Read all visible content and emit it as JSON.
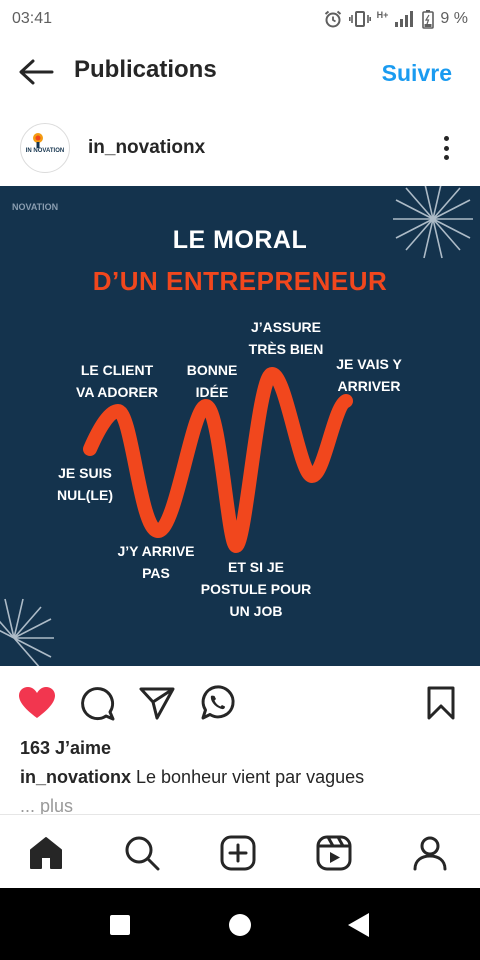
{
  "status_bar": {
    "time": "03:41",
    "network": "H+",
    "battery": "9 %"
  },
  "header": {
    "title": "Publications",
    "follow_label": "Suivre"
  },
  "post": {
    "username": "in_novationx",
    "avatar_text": "IN NOVATION",
    "image": {
      "brand": "NOVATION",
      "title_line1": "LE MORAL",
      "title_line2": "D’UN ENTREPRENEUR",
      "labels": {
        "le_client": "LE CLIENT\nVA ADORER",
        "bonne_idee": "BONNE\nIDÉE",
        "jassure": "J’ASSURE\nTRÈS BIEN",
        "je_vais": "JE VAIS Y\nARRIVER",
        "je_suis": "JE SUIS\nNUL(LE)",
        "jy_arrive": "J’Y ARRIVE\nPAS",
        "et_si": "ET SI JE\nPOSTULE POUR\nUN JOB"
      },
      "colors": {
        "background": "#14334d",
        "accent": "#f1471d",
        "text": "#ffffff"
      }
    },
    "likes": "163 J’aime",
    "caption_user": "in_novationx",
    "caption_text": " Le bonheur vient par vagues",
    "more_label": "... plus"
  },
  "icons": {
    "like": "heart-icon",
    "comment": "comment-icon",
    "share": "send-icon",
    "whatsapp": "whatsapp-icon",
    "save": "bookmark-icon"
  }
}
